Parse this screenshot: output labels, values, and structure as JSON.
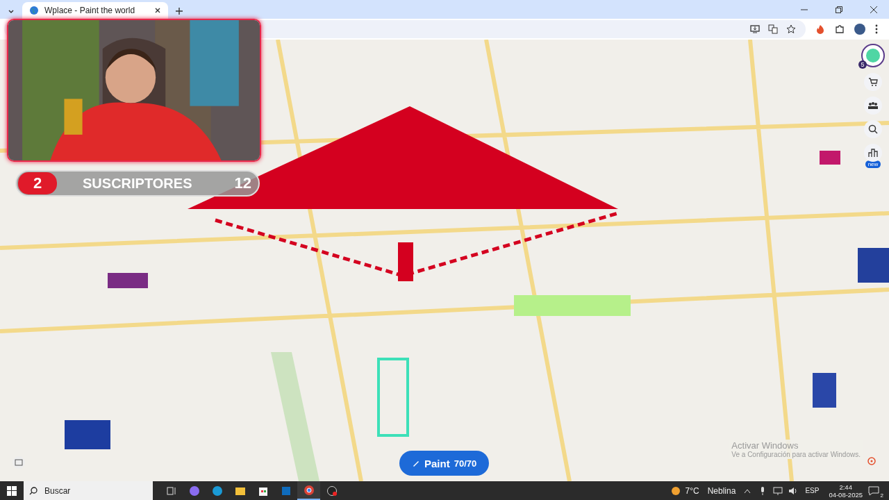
{
  "browser": {
    "tabs": [
      {
        "title": "Wplace - Paint the world",
        "selected": true
      }
    ]
  },
  "stream_overlay": {
    "current": "2",
    "label": "SUSCRIPTORES",
    "goal": "12"
  },
  "side_toolbar": {
    "badge": "5",
    "new_label": "new"
  },
  "paint_button": {
    "label": "Paint",
    "count": "70/70"
  },
  "activation_notice": {
    "title": "Activar Windows",
    "text": "Ve a Configuración para activar Windows."
  },
  "taskbar": {
    "search_placeholder": "Buscar",
    "temperature": "7°C",
    "weather": "Neblina",
    "language": "ESP",
    "time": "2:44",
    "date": "04-08-2025",
    "notifications": "2"
  }
}
